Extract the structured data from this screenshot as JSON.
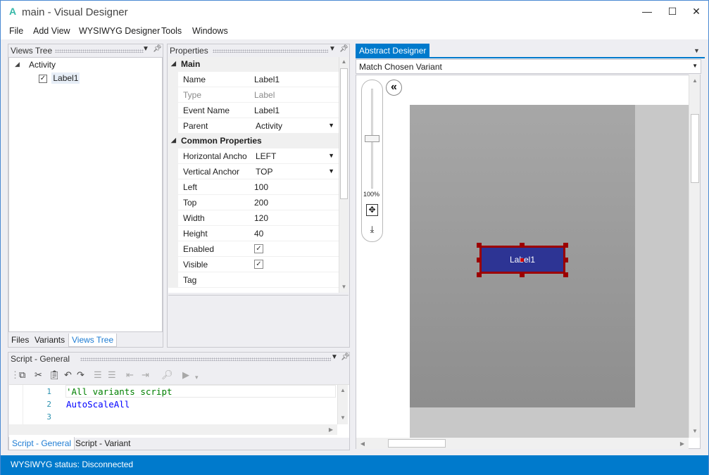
{
  "window": {
    "app_icon": "A",
    "title": "main - Visual Designer",
    "minimize_glyph": "—",
    "maximize_glyph": "☐",
    "close_glyph": "✕"
  },
  "menu": [
    "File",
    "Add View",
    "WYSIWYG Designer",
    "Tools",
    "Windows"
  ],
  "views_tree": {
    "title": "Views Tree",
    "root": "Activity",
    "child": "Label1",
    "child_checked": true,
    "tabs": [
      "Files",
      "Variants",
      "Views Tree"
    ],
    "active_tab": "Views Tree"
  },
  "properties": {
    "title": "Properties",
    "categories": [
      {
        "name": "Main",
        "rows": [
          {
            "name": "Name",
            "value": "Label1",
            "type": "text"
          },
          {
            "name": "Type",
            "value": "Label",
            "type": "readonly"
          },
          {
            "name": "Event Name",
            "value": "Label1",
            "type": "text"
          },
          {
            "name": "Parent",
            "value": "Activity",
            "type": "dropdown"
          }
        ]
      },
      {
        "name": "Common Properties",
        "rows": [
          {
            "name": "Horizontal Ancho",
            "value": "LEFT",
            "type": "dropdown"
          },
          {
            "name": "Vertical Anchor",
            "value": "TOP",
            "type": "dropdown"
          },
          {
            "name": "Left",
            "value": "100",
            "type": "text"
          },
          {
            "name": "Top",
            "value": "200",
            "type": "text"
          },
          {
            "name": "Width",
            "value": "120",
            "type": "text"
          },
          {
            "name": "Height",
            "value": "40",
            "type": "text"
          },
          {
            "name": "Enabled",
            "value": "✓",
            "type": "check"
          },
          {
            "name": "Visible",
            "value": "✓",
            "type": "check"
          },
          {
            "name": "Tag",
            "value": "",
            "type": "text"
          }
        ]
      }
    ]
  },
  "script": {
    "title": "Script - General",
    "lines": [
      {
        "no": "1",
        "text": "'All variants script",
        "color": "#008000"
      },
      {
        "no": "2",
        "text": "AutoScaleAll",
        "color": "#0000ff"
      },
      {
        "no": "3",
        "text": "",
        "color": "#000000"
      }
    ],
    "tabs": [
      "Script - General",
      "Script - Variant"
    ],
    "active_tab": "Script - General"
  },
  "designer": {
    "tab": "Abstract Designer",
    "variant": "Match Chosen Variant",
    "zoom_label": "100%",
    "zoom_level": 0.5,
    "collapse_glyph": "«",
    "label_text": "Label1",
    "label_bg": "#2d3494",
    "selection_color": "#9c0000"
  },
  "status": {
    "text": "WYSIWYG status: Disconnected"
  },
  "colors": {
    "accent": "#007acc",
    "status_bar": "#007acc"
  }
}
